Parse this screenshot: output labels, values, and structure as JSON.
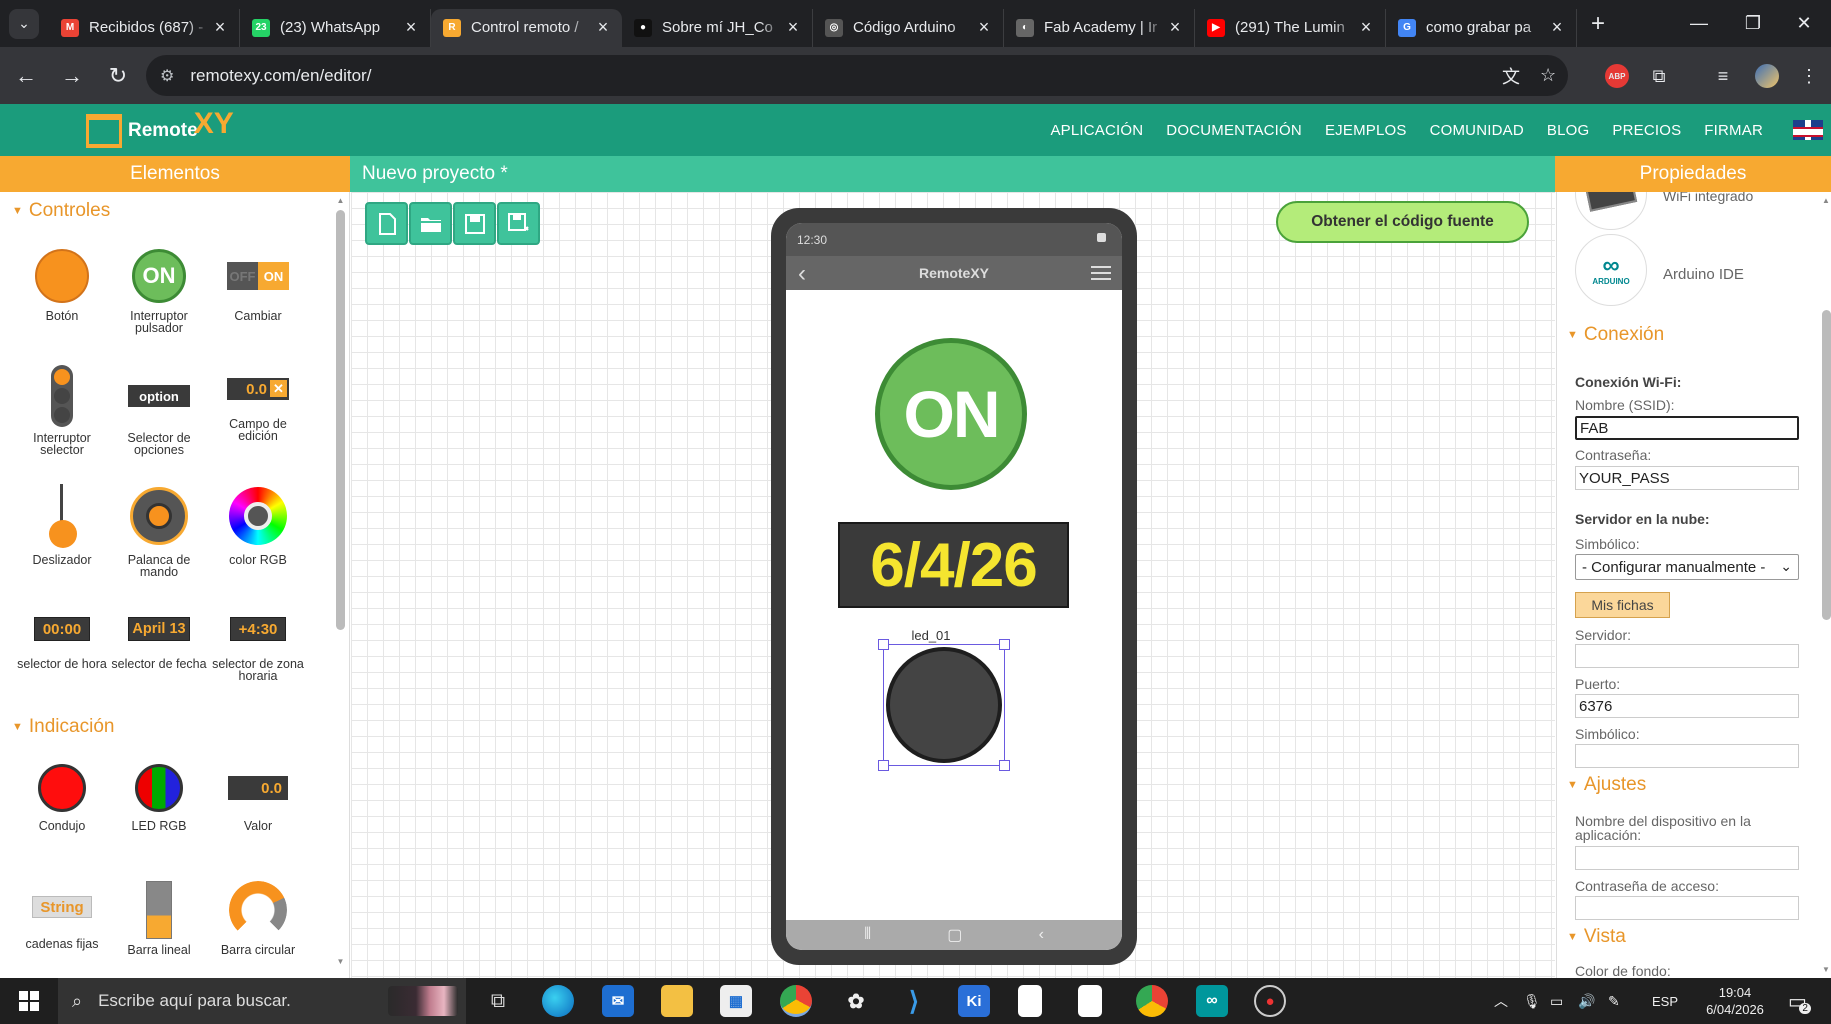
{
  "browser": {
    "tabs": [
      {
        "title": "Recibidos (687) -",
        "fav_color": "#ea4335",
        "fav_glyph": "M"
      },
      {
        "title": "(23) WhatsApp",
        "fav_color": "#25d366",
        "fav_glyph": "23"
      },
      {
        "title": "Control remoto /",
        "fav_color": "#f7a931",
        "fav_glyph": "R",
        "active": true
      },
      {
        "title": "Sobre mí JH_Co",
        "fav_color": "#111111",
        "fav_glyph": "●"
      },
      {
        "title": "Código Arduino",
        "fav_color": "#555555",
        "fav_glyph": "◎"
      },
      {
        "title": "Fab Academy | Ir",
        "fav_color": "#666666",
        "fav_glyph": "◐"
      },
      {
        "title": "(291) The Lumin",
        "fav_color": "#ff0000",
        "fav_glyph": "▶"
      },
      {
        "title": "como grabar pa",
        "fav_color": "#4285f4",
        "fav_glyph": "G"
      }
    ],
    "url": "remotexy.com/en/editor/",
    "ext_abp": "ABP"
  },
  "site": {
    "logo_word": "Remote",
    "logo_xy": "XY",
    "nav": [
      "APLICACIÓN",
      "DOCUMENTACIÓN",
      "EJEMPLOS",
      "COMUNIDAD",
      "BLOG",
      "PRECIOS",
      "FIRMAR"
    ]
  },
  "headers": {
    "left": "Elementos",
    "mid": "Nuevo proyecto *",
    "right": "Propiedades"
  },
  "elements": {
    "controls_title": "Controles",
    "indication_title": "Indicación",
    "controls": [
      {
        "label": "Botón"
      },
      {
        "label": "Interruptor pulsador",
        "text": "ON"
      },
      {
        "label": "Cambiar",
        "text_off": "OFF",
        "text_on": "ON"
      },
      {
        "label": "Interruptor selector"
      },
      {
        "label": "Selector de opciones",
        "text": "option"
      },
      {
        "label": "Campo de edición",
        "text": "0.0"
      },
      {
        "label": "Deslizador"
      },
      {
        "label": "Palanca de mando"
      },
      {
        "label": "color RGB"
      },
      {
        "label": "selector de hora",
        "text": "00:00"
      },
      {
        "label": "selector de fecha",
        "text": "April 13"
      },
      {
        "label": "selector de zona horaria",
        "text": "+4:30"
      }
    ],
    "indication": [
      {
        "label": "Condujo"
      },
      {
        "label": "LED RGB"
      },
      {
        "label": "Valor",
        "text": "0.0"
      },
      {
        "label": "cadenas fijas",
        "text": "String"
      },
      {
        "label": "Barra lineal"
      },
      {
        "label": "Barra circular"
      }
    ]
  },
  "canvas": {
    "get_code": "Obtener el código fuente",
    "phone": {
      "time": "12:30",
      "app_title": "RemoteXY",
      "button_text": "ON",
      "date_text": "6/4/26",
      "led_label": "led_01"
    }
  },
  "properties": {
    "card1_label": "WiFi integrado",
    "card2_label": "Arduino IDE",
    "card2_logo": "ARDUINO",
    "connection_title": "Conexión",
    "wifi_heading": "Conexión Wi-Fi:",
    "ssid_label": "Nombre (SSID):",
    "ssid_value": "FAB",
    "pass_label": "Contraseña:",
    "pass_value": "YOUR_PASS",
    "cloud_heading": "Servidor en la nube:",
    "symbolic_label": "Simbólico:",
    "symbolic_value": "- Configurar manualmente -",
    "my_tokens": "Mis fichas",
    "server_label": "Servidor:",
    "server_value": "",
    "port_label": "Puerto:",
    "port_value": "6376",
    "symbolic2_label": "Simbólico:",
    "symbolic2_value": "",
    "settings_title": "Ajustes",
    "device_name_label": "Nombre del dispositivo en la aplicación:",
    "device_name_value": "",
    "access_pass_label": "Contraseña de acceso:",
    "access_pass_value": "",
    "view_title": "Vista",
    "bg_color_label": "Color de fondo:"
  },
  "taskbar": {
    "search_placeholder": "Escribe aquí para buscar.",
    "lang": "ESP",
    "time": "19:04",
    "date": "6/04/2026",
    "notif_count": "2"
  }
}
